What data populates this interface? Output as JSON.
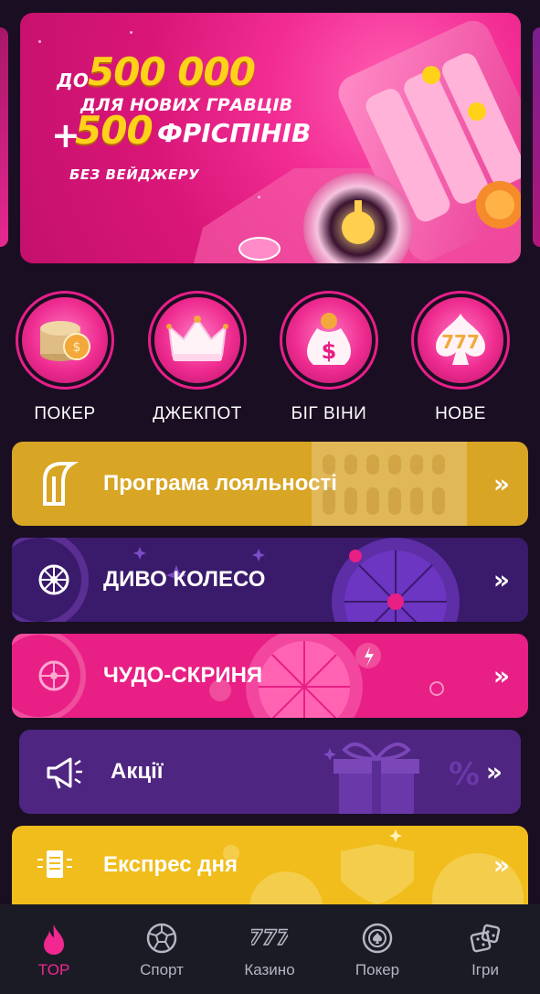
{
  "banner": {
    "prefix": "ДО",
    "amount": "500 000",
    "line2": "ДЛЯ НОВИХ ГРАВЦІВ",
    "plus": "+",
    "freespins_count": "500",
    "freespins_label": "ФРІСПІНІВ",
    "line4": "БЕЗ ВЕЙДЖЕРУ"
  },
  "categories": [
    {
      "label": "ПОКЕР",
      "icon": "poker-chips-icon"
    },
    {
      "label": "ДЖЕКПОТ",
      "icon": "crown-icon"
    },
    {
      "label": "БІГ ВІНИ",
      "icon": "money-bag-icon"
    },
    {
      "label": "НОВЕ",
      "icon": "sevens-icon"
    }
  ],
  "cards": {
    "loyalty": {
      "title": "Програма лояльності",
      "arrow": "»",
      "color": "#d8a524"
    },
    "wheel": {
      "title": "ДИВО КОЛЕСО",
      "arrow": "»",
      "color": "#3a1a6b"
    },
    "chest": {
      "title": "ЧУДО-СКРИНЯ",
      "arrow": "»",
      "color": "#e81f84"
    },
    "promos": {
      "title": "Акції",
      "arrow": "»",
      "color": "#4e2580"
    },
    "express": {
      "title": "Експрес дня",
      "arrow": "»",
      "color": "#f0bd1c"
    }
  },
  "nav": [
    {
      "label": "TOP",
      "icon": "flame-icon",
      "active": true
    },
    {
      "label": "Спорт",
      "icon": "soccer-ball-icon"
    },
    {
      "label": "Казино",
      "icon": "sevens-icon"
    },
    {
      "label": "Покер",
      "icon": "poker-chip-icon"
    },
    {
      "label": "Ігри",
      "icon": "dice-icon"
    }
  ],
  "colors": {
    "accent": "#f0288f",
    "background": "#1a0e22",
    "nav_background": "#1b1b26"
  }
}
